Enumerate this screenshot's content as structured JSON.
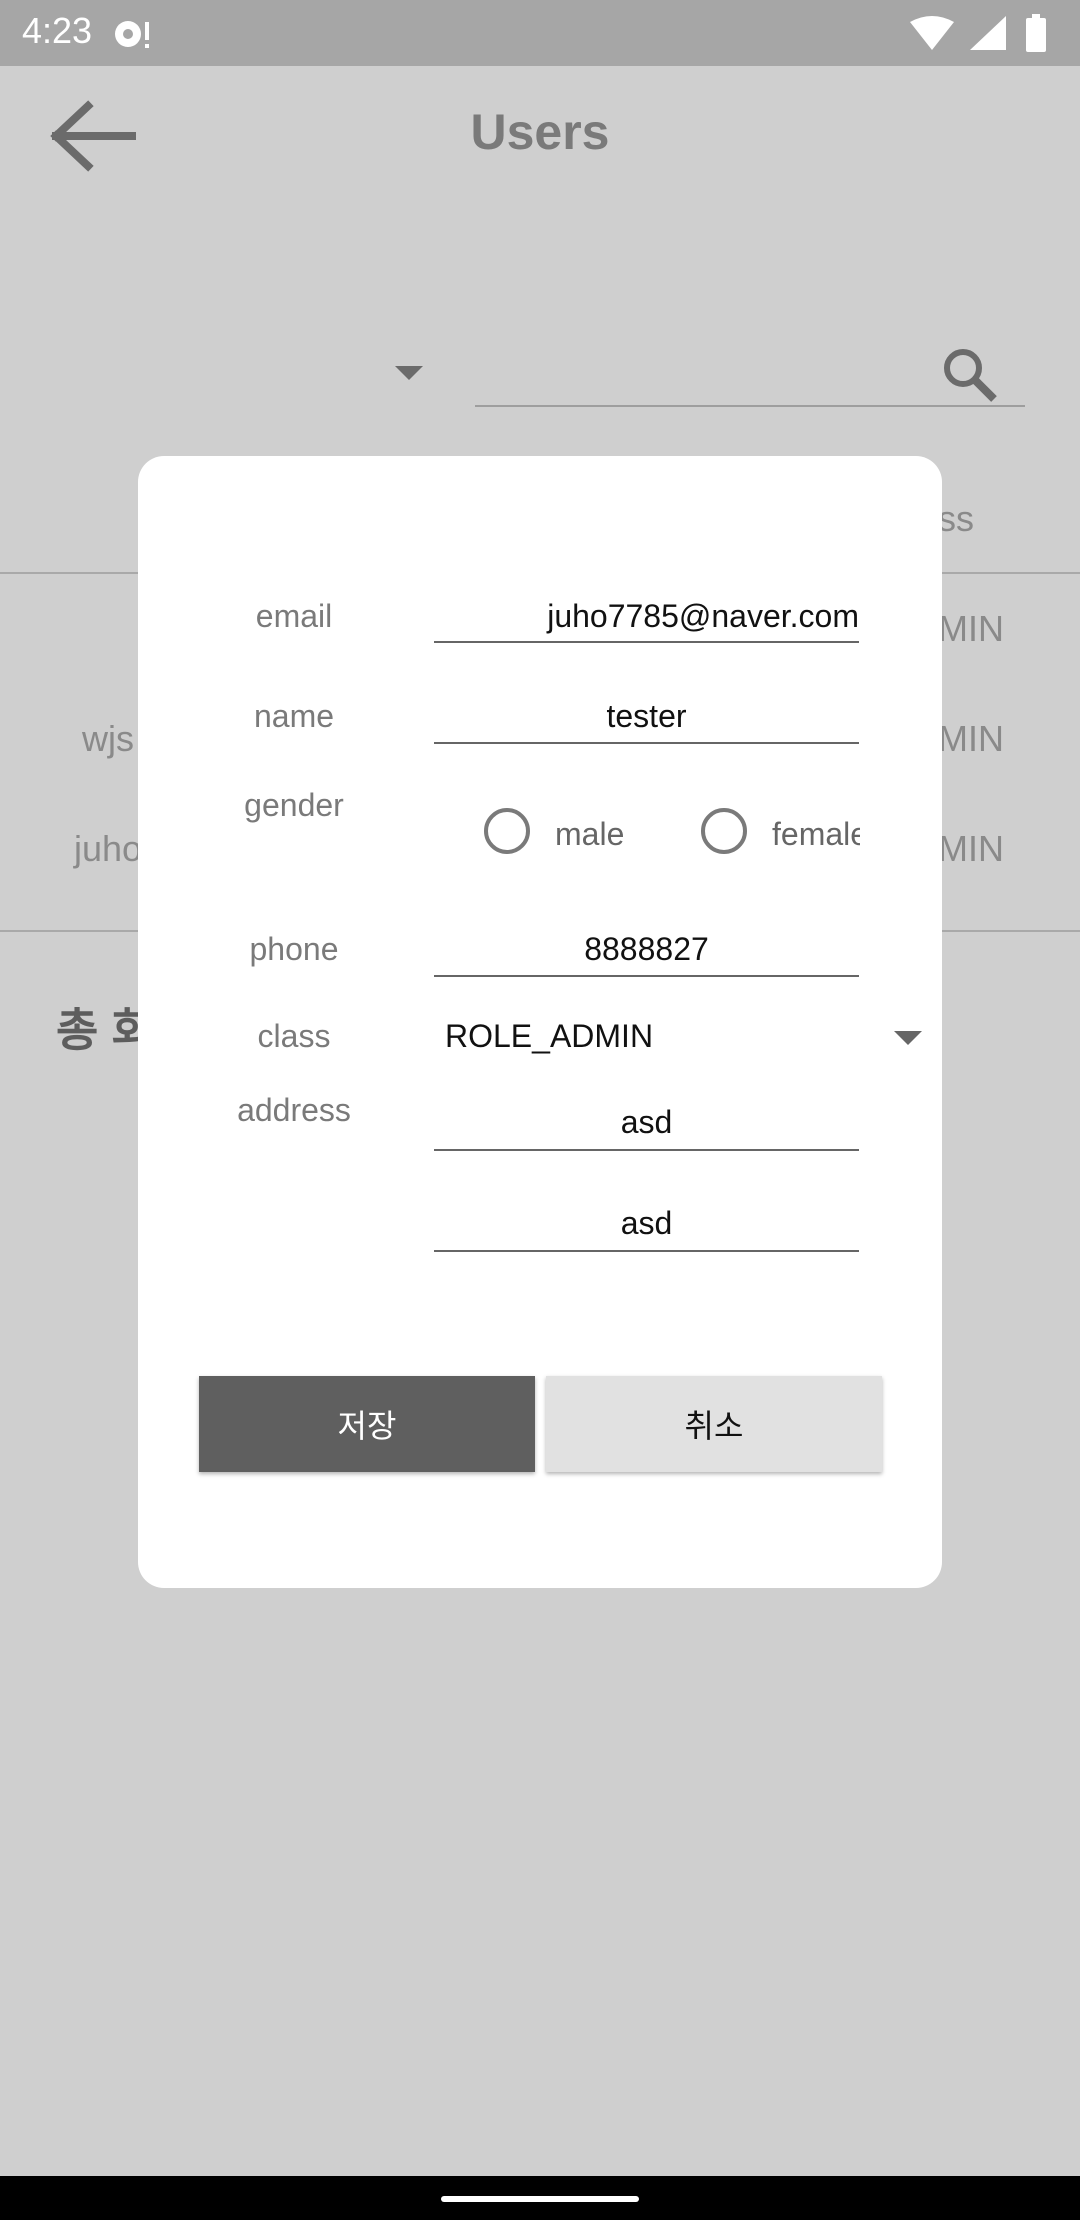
{
  "status_bar": {
    "time": "4:23"
  },
  "background": {
    "title": "Users",
    "col_header_fragment": "ass",
    "rows": [
      {
        "left_fragment": "",
        "right_fragment": "MIN"
      },
      {
        "left_fragment": "wjs",
        "right_fragment": "MIN"
      },
      {
        "left_fragment": "juho",
        "right_fragment": "MIN"
      }
    ],
    "total_fragment": "총 회"
  },
  "dialog": {
    "email": {
      "label": "email",
      "value": "juho7785@naver.com"
    },
    "name": {
      "label": "name",
      "value": "tester"
    },
    "gender": {
      "label": "gender",
      "options": [
        "male",
        "female"
      ],
      "selected": null
    },
    "phone": {
      "label": "phone",
      "value": "8888827"
    },
    "class": {
      "label": "class",
      "value": "ROLE_ADMIN"
    },
    "address": {
      "label": "address",
      "line1": "asd",
      "line2": "asd"
    },
    "save_label": "저장",
    "cancel_label": "취소"
  },
  "colors": {
    "scrim": "#cfcfcf",
    "save_button": "#5f5f5f",
    "cancel_button": "#e1e1e1"
  }
}
